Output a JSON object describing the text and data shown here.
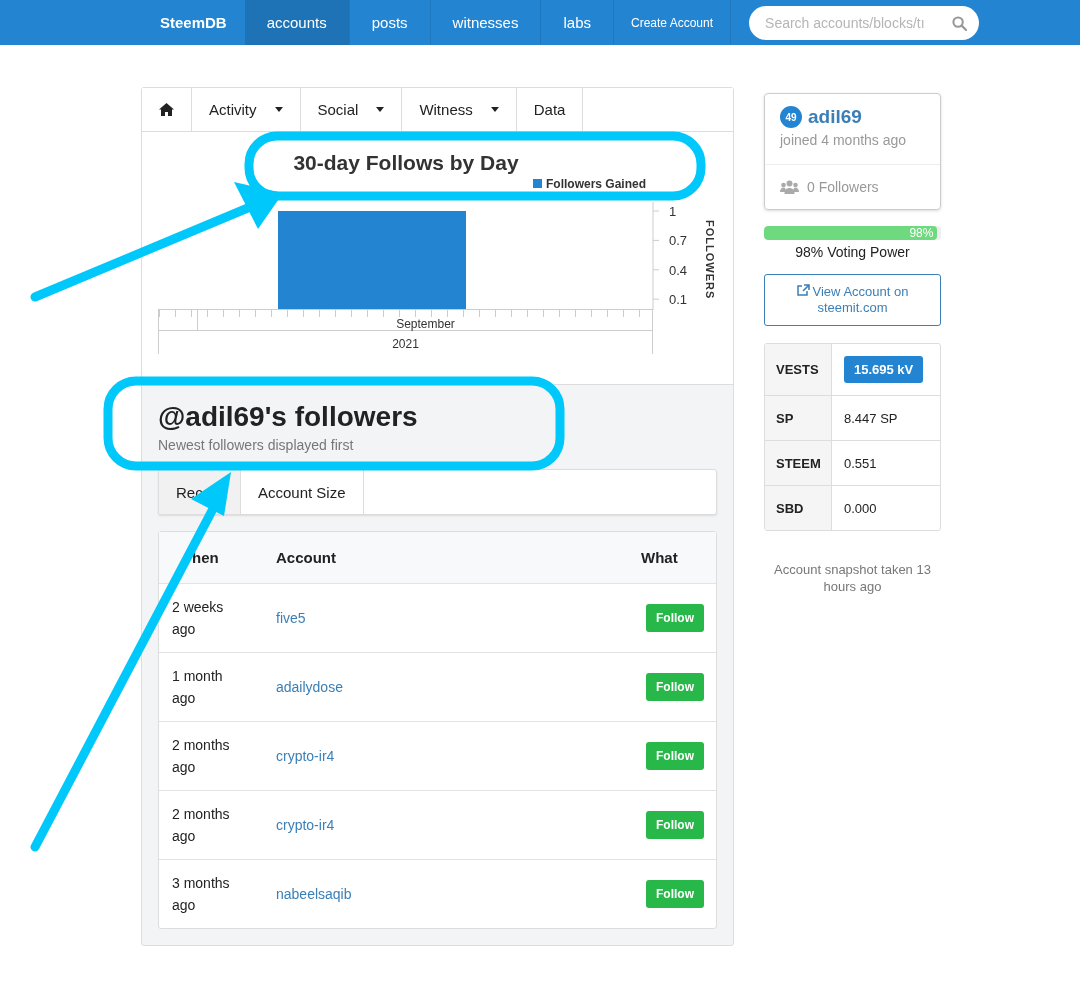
{
  "navbar": {
    "brand": "SteemDB",
    "items": [
      {
        "label": "accounts",
        "selected": true,
        "kind": "large"
      },
      {
        "label": "posts",
        "selected": false,
        "kind": "large"
      },
      {
        "label": "witnesses",
        "selected": false,
        "kind": "large"
      },
      {
        "label": "labs",
        "selected": false,
        "kind": "large"
      },
      {
        "label": "Create Account",
        "selected": false,
        "kind": "small"
      }
    ],
    "search": {
      "placeholder": "Search accounts/blocks/tı"
    }
  },
  "section_tabs": [
    {
      "label": "Activity",
      "dropdown": true
    },
    {
      "label": "Social",
      "dropdown": true
    },
    {
      "label": "Witness",
      "dropdown": true
    },
    {
      "label": "Data",
      "dropdown": false
    }
  ],
  "chart": {
    "chart_data": {
      "type": "bar",
      "title": "30-day Follows by Day",
      "ylabel": "FOLLOWERS",
      "xlabel": "2021",
      "categories": [
        "September"
      ],
      "series": [
        {
          "name": "Followers Gained",
          "color": "#2385d1",
          "values": [
            1
          ]
        }
      ],
      "ylim": [
        0,
        1
      ],
      "yticks": [
        0.1,
        0.4,
        0.7,
        1
      ]
    }
  },
  "followers": {
    "title": "@adil69's followers",
    "subtitle": "Newest followers displayed first",
    "tabs": [
      {
        "label": "Rec",
        "selected": true
      },
      {
        "label": "Account Size",
        "selected": false
      }
    ],
    "columns": [
      "hen",
      "Account",
      "What"
    ],
    "rows": [
      {
        "when": "2 weeks ago",
        "account": "five5",
        "what": "Follow"
      },
      {
        "when": "1 month ago",
        "account": "adailydose",
        "what": "Follow"
      },
      {
        "when": "2 months ago",
        "account": "crypto-ir4",
        "what": "Follow"
      },
      {
        "when": "2 months ago",
        "account": "crypto-ir4",
        "what": "Follow"
      },
      {
        "when": "3 months ago",
        "account": "nabeelsaqib",
        "what": "Follow"
      }
    ]
  },
  "profile": {
    "reputation": "49",
    "name": "adil69",
    "joined": "joined 4 months ago",
    "followers": "0 Followers"
  },
  "voting_power": {
    "level": 0.98,
    "bar_text": "98%",
    "label": "98% Voting Power"
  },
  "view_button": "View Account on steemit.com",
  "stats": [
    {
      "label": "VESTS",
      "value": "15.695 kV",
      "kind": "badge"
    },
    {
      "label": "SP",
      "value": "8.447 SP",
      "kind": "plain"
    },
    {
      "label": "STEEM",
      "value": "0.551",
      "kind": "plain"
    },
    {
      "label": "SBD",
      "value": "0.000",
      "kind": "plain"
    }
  ],
  "snapshot": "Account snapshot taken 13 hours ago"
}
